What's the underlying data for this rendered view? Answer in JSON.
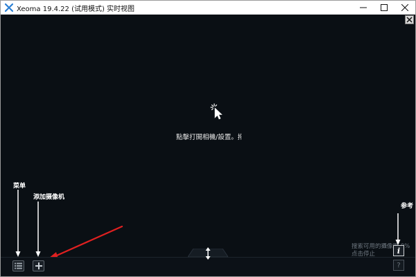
{
  "window": {
    "title": "Xeoma 19.4.22 (试用模式) 实时视图",
    "controls": {
      "minimize_icon": "minimize-icon",
      "maximize_icon": "maximize-icon",
      "close_icon": "close-icon"
    }
  },
  "viewport": {
    "hint": "點擊打開相機/設置。拖",
    "search_status_line1": "搜索可用的攝像機 0%",
    "search_status_line2": "点击停止"
  },
  "annotations": {
    "menu": "菜单",
    "add_camera": "添加摄像机",
    "reference": "参考"
  },
  "toolbar": {
    "menu_icon": "list-icon",
    "add_icon": "plus-icon",
    "info_label": "i",
    "help_label": "?"
  },
  "colors": {
    "background": "#0a0f14",
    "annotation_arrow_red": "#e02020",
    "annotation_arrow_white": "#ffffff",
    "app_icon_blue": "#2a7fd4"
  }
}
